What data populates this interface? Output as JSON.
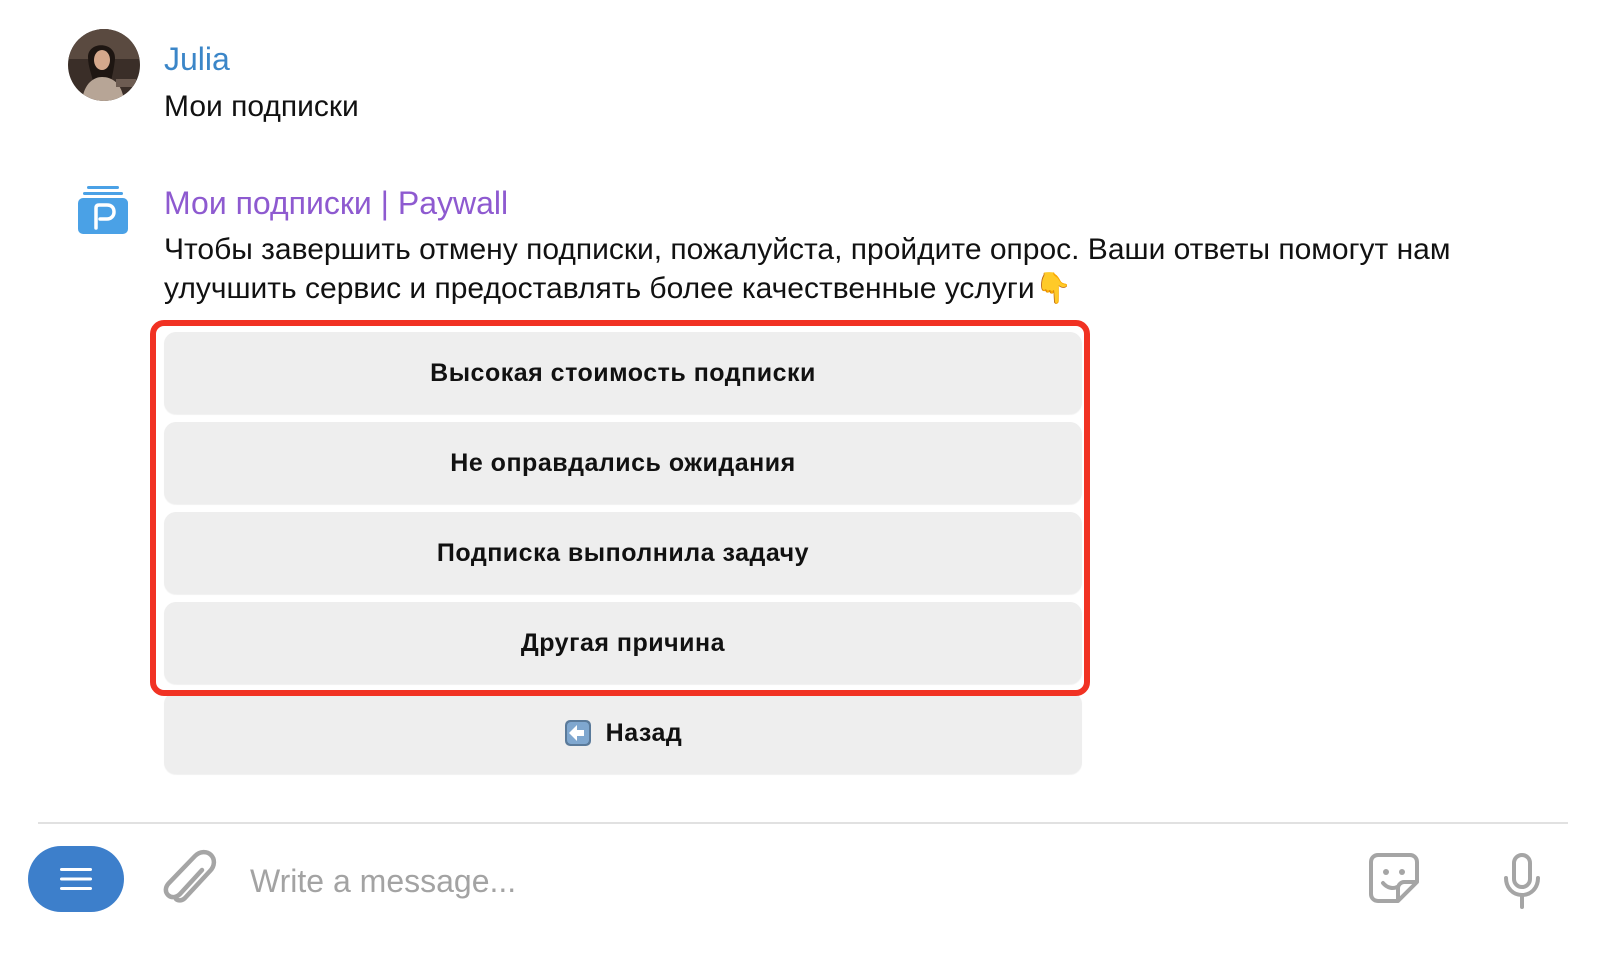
{
  "messages": [
    {
      "sender": "Julia",
      "text": "Мои подписки"
    },
    {
      "sender": "Мои подписки | Paywall",
      "text": "Чтобы завершить отмену подписки, пожалуйста, пройдите опрос. Ваши ответы помогут нам улучшить сервис и предоставлять более качественные услуги👇"
    }
  ],
  "keyboard": {
    "options": [
      "Высокая стоимость подписки",
      "Не оправдались ожидания",
      "Подписка выполнила задачу",
      "Другая причина"
    ],
    "back_label": "Назад"
  },
  "composer": {
    "placeholder": "Write a message..."
  },
  "icons": {
    "menu": "menu-icon",
    "attach": "paperclip-icon",
    "sticker": "sticker-icon",
    "mic": "microphone-icon",
    "back": "back-arrow-emoji"
  },
  "colors": {
    "user_name": "#3b86c8",
    "bot_name": "#8e5ad0",
    "menu_button": "#3d7fcb",
    "highlight": "#f13223",
    "keyboard_button": "#eeeeee"
  }
}
